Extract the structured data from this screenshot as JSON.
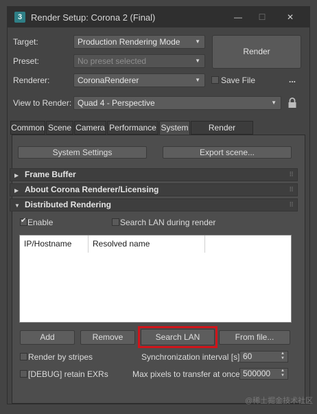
{
  "window": {
    "title": "Render Setup: Corona 2 (Final)",
    "icon_text": "3",
    "controls": {
      "minimize": "—",
      "maximize": "☐",
      "close": "✕"
    }
  },
  "settings": {
    "target_label": "Target:",
    "target_value": "Production Rendering Mode",
    "preset_label": "Preset:",
    "preset_value": "No preset selected",
    "renderer_label": "Renderer:",
    "renderer_value": "CoronaRenderer",
    "save_file_label": "Save File",
    "more_label": "...",
    "view_label": "View to Render:",
    "view_value": "Quad 4 - Perspective",
    "render_button": "Render"
  },
  "tabs": [
    "Common",
    "Scene",
    "Camera",
    "Performance",
    "System",
    "Render Elements"
  ],
  "system": {
    "system_settings_button": "System Settings",
    "export_scene_button": "Export scene...",
    "rollouts": [
      "Frame Buffer",
      "About Corona Renderer/Licensing",
      "Distributed Rendering"
    ],
    "enable_label": "Enable",
    "search_lan_during_render_label": "Search LAN during render",
    "list_columns": [
      "IP/Hostname",
      "Resolved name"
    ],
    "buttons": {
      "add": "Add",
      "remove": "Remove",
      "search_lan": "Search LAN",
      "from_file": "From file..."
    },
    "render_by_stripes_label": "Render by stripes",
    "debug_retain_label": "[DEBUG] retain EXRs",
    "sync_interval_label": "Synchronization interval [s]:",
    "sync_interval_value": "60",
    "max_pixels_label": "Max pixels to transfer at once:",
    "max_pixels_value": "500000"
  },
  "watermark": "@稀土掘金技术社区",
  "colors": {
    "highlight": "#d0141a",
    "icon": "#2f7f86"
  }
}
